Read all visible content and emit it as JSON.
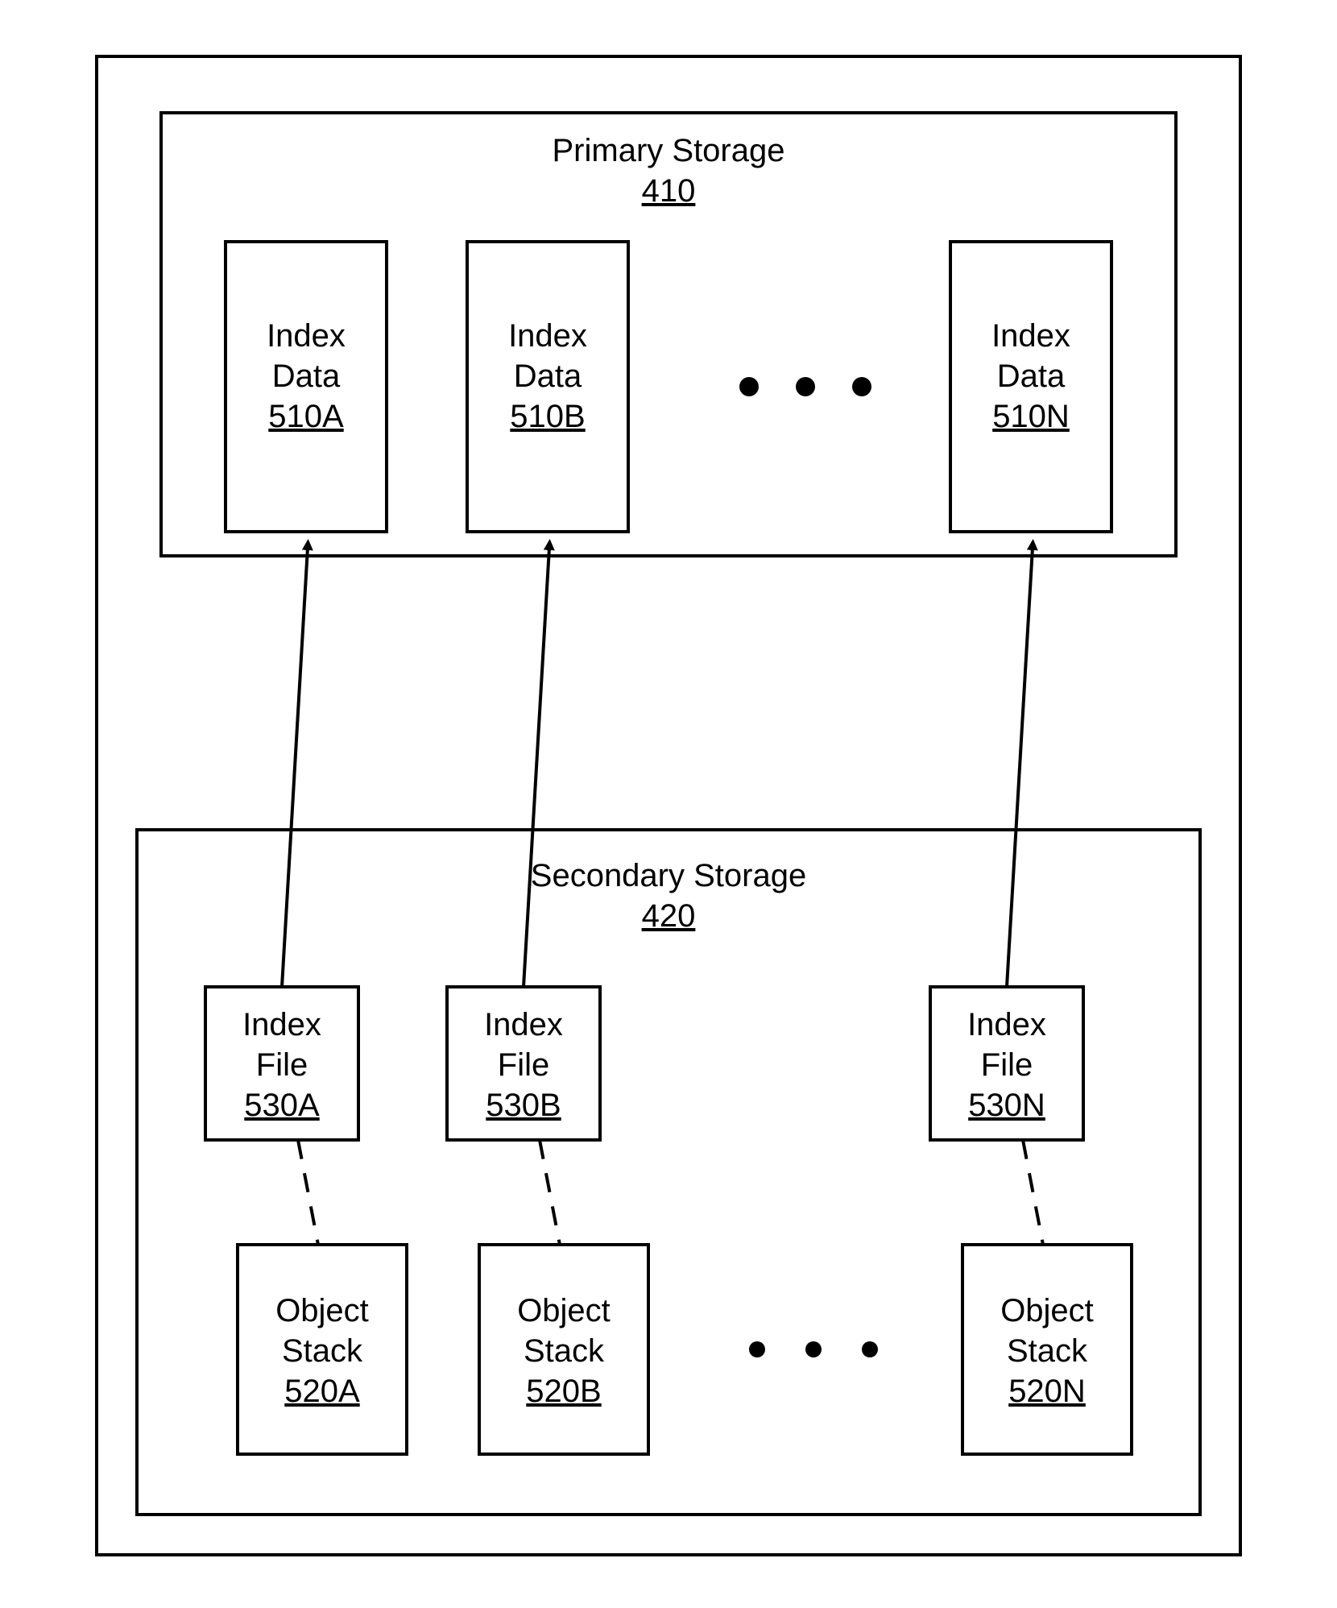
{
  "primary": {
    "title": "Primary Storage",
    "ref": "410",
    "items": [
      {
        "label1": "Index",
        "label2": "Data",
        "ref": "510A"
      },
      {
        "label1": "Index",
        "label2": "Data",
        "ref": "510B"
      },
      {
        "label1": "Index",
        "label2": "Data",
        "ref": "510N"
      }
    ]
  },
  "secondary": {
    "title": "Secondary Storage",
    "ref": "420",
    "indexFiles": [
      {
        "label1": "Index",
        "label2": "File",
        "ref": "530A"
      },
      {
        "label1": "Index",
        "label2": "File",
        "ref": "530B"
      },
      {
        "label1": "Index",
        "label2": "File",
        "ref": "530N"
      }
    ],
    "objectStacks": [
      {
        "label1": "Object",
        "label2": "Stack",
        "ref": "520A"
      },
      {
        "label1": "Object",
        "label2": "Stack",
        "ref": "520B"
      },
      {
        "label1": "Object",
        "label2": "Stack",
        "ref": "520N"
      }
    ]
  }
}
